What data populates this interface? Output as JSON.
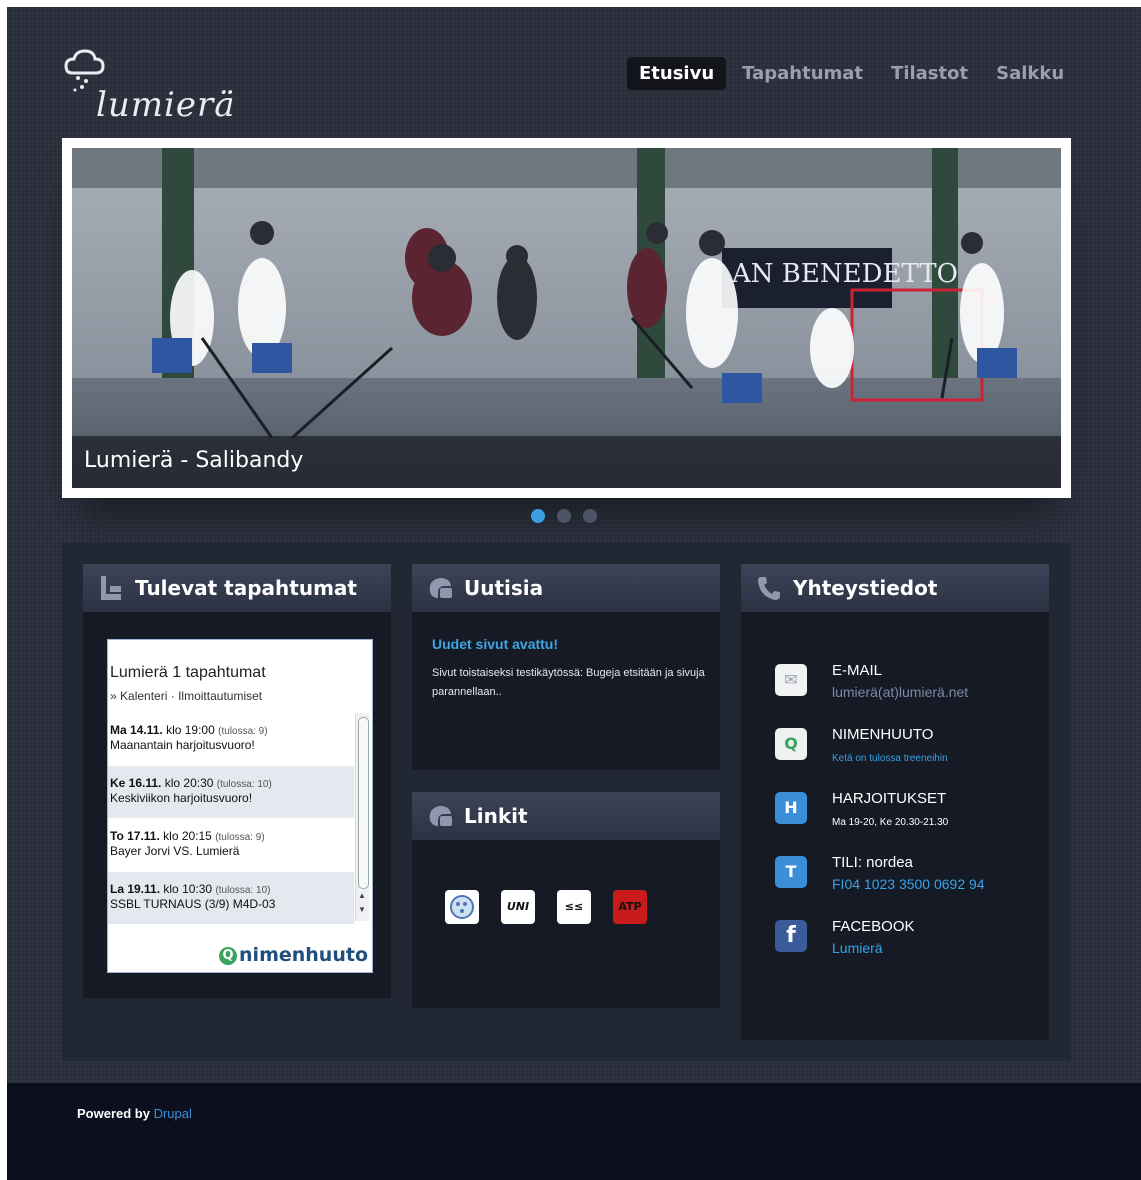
{
  "brand": {
    "name": "lumierä",
    "colors": {
      "accent": "#3ea6e6",
      "background": "#2a2f3c",
      "footer": "#0c0f1d"
    }
  },
  "nav": {
    "items": [
      {
        "label": "Etusivu",
        "active": true
      },
      {
        "label": "Tapahtumat",
        "active": false
      },
      {
        "label": "Tilastot",
        "active": false
      },
      {
        "label": "Salkku",
        "active": false
      }
    ]
  },
  "hero": {
    "caption": "Lumierä - Salibandy",
    "banner_text": "AN BENEDETTO",
    "slide_count": 3,
    "active_slide": 1
  },
  "events": {
    "heading": "Tulevat tapahtumat",
    "widget_title": "Lumierä 1 tapahtumat",
    "widget_prefix": "»",
    "widget_links": [
      "Kalenteri",
      "Ilmoittautumiset"
    ],
    "widget_separator": "·",
    "items": [
      {
        "day": "Ma 14.11.",
        "time": "klo 19:00",
        "count": "(tulossa: 9)",
        "title": "Maanantain harjoitusvuoro!"
      },
      {
        "day": "Ke 16.11.",
        "time": "klo 20:30",
        "count": "(tulossa: 10)",
        "title": "Keskiviikon harjoitusvuoro!"
      },
      {
        "day": "To 17.11.",
        "time": "klo 20:15",
        "count": "(tulossa: 9)",
        "title": "Bayer Jorvi VS. Lumierä"
      },
      {
        "day": "La 19.11.",
        "time": "klo 10:30",
        "count": "(tulossa: 10)",
        "title": "SSBL TURNAUS (3/9) M4D-03"
      }
    ],
    "widget_logo": "nimenhuuto",
    "widget_logo_mark": "Q"
  },
  "news": {
    "heading": "Uutisia",
    "title": "Uudet sivut avattu!",
    "body": "Sivut toistaiseksi testikäytössä: Bugeja etsitään ja sivuja parannellaan.."
  },
  "links": {
    "heading": "Linkit",
    "items": [
      {
        "icon": "floorball-ball-icon",
        "text": ""
      },
      {
        "icon": "unihoc-logo-icon",
        "text": "UNI"
      },
      {
        "icon": "exel-logo-icon",
        "text": "≤≤"
      },
      {
        "icon": "atp-logo-icon",
        "text": "ATP"
      }
    ]
  },
  "contact": {
    "heading": "Yhteystiedot",
    "items": [
      {
        "icon": "email-icon",
        "glyph": "✉",
        "label": "E-MAIL",
        "value": "lumierä(at)lumierä.net"
      },
      {
        "icon": "nimenhuuto-icon",
        "glyph": "Q",
        "label": "NIMENHUUTO",
        "value": "Ketä on tulossa treeneihin"
      },
      {
        "icon": "harjoitukset-icon",
        "glyph": "H",
        "label": "HARJOITUKSET",
        "value": "Ma 19-20, Ke 20.30-21.30"
      },
      {
        "icon": "tili-icon",
        "glyph": "T",
        "label": "TILI: nordea",
        "value": "FI04 1023 3500 0692 94"
      },
      {
        "icon": "facebook-icon",
        "glyph": "f",
        "label": "FACEBOOK",
        "value": "Lumierä"
      }
    ]
  },
  "footer": {
    "powered_by": "Powered by",
    "link": "Drupal"
  }
}
